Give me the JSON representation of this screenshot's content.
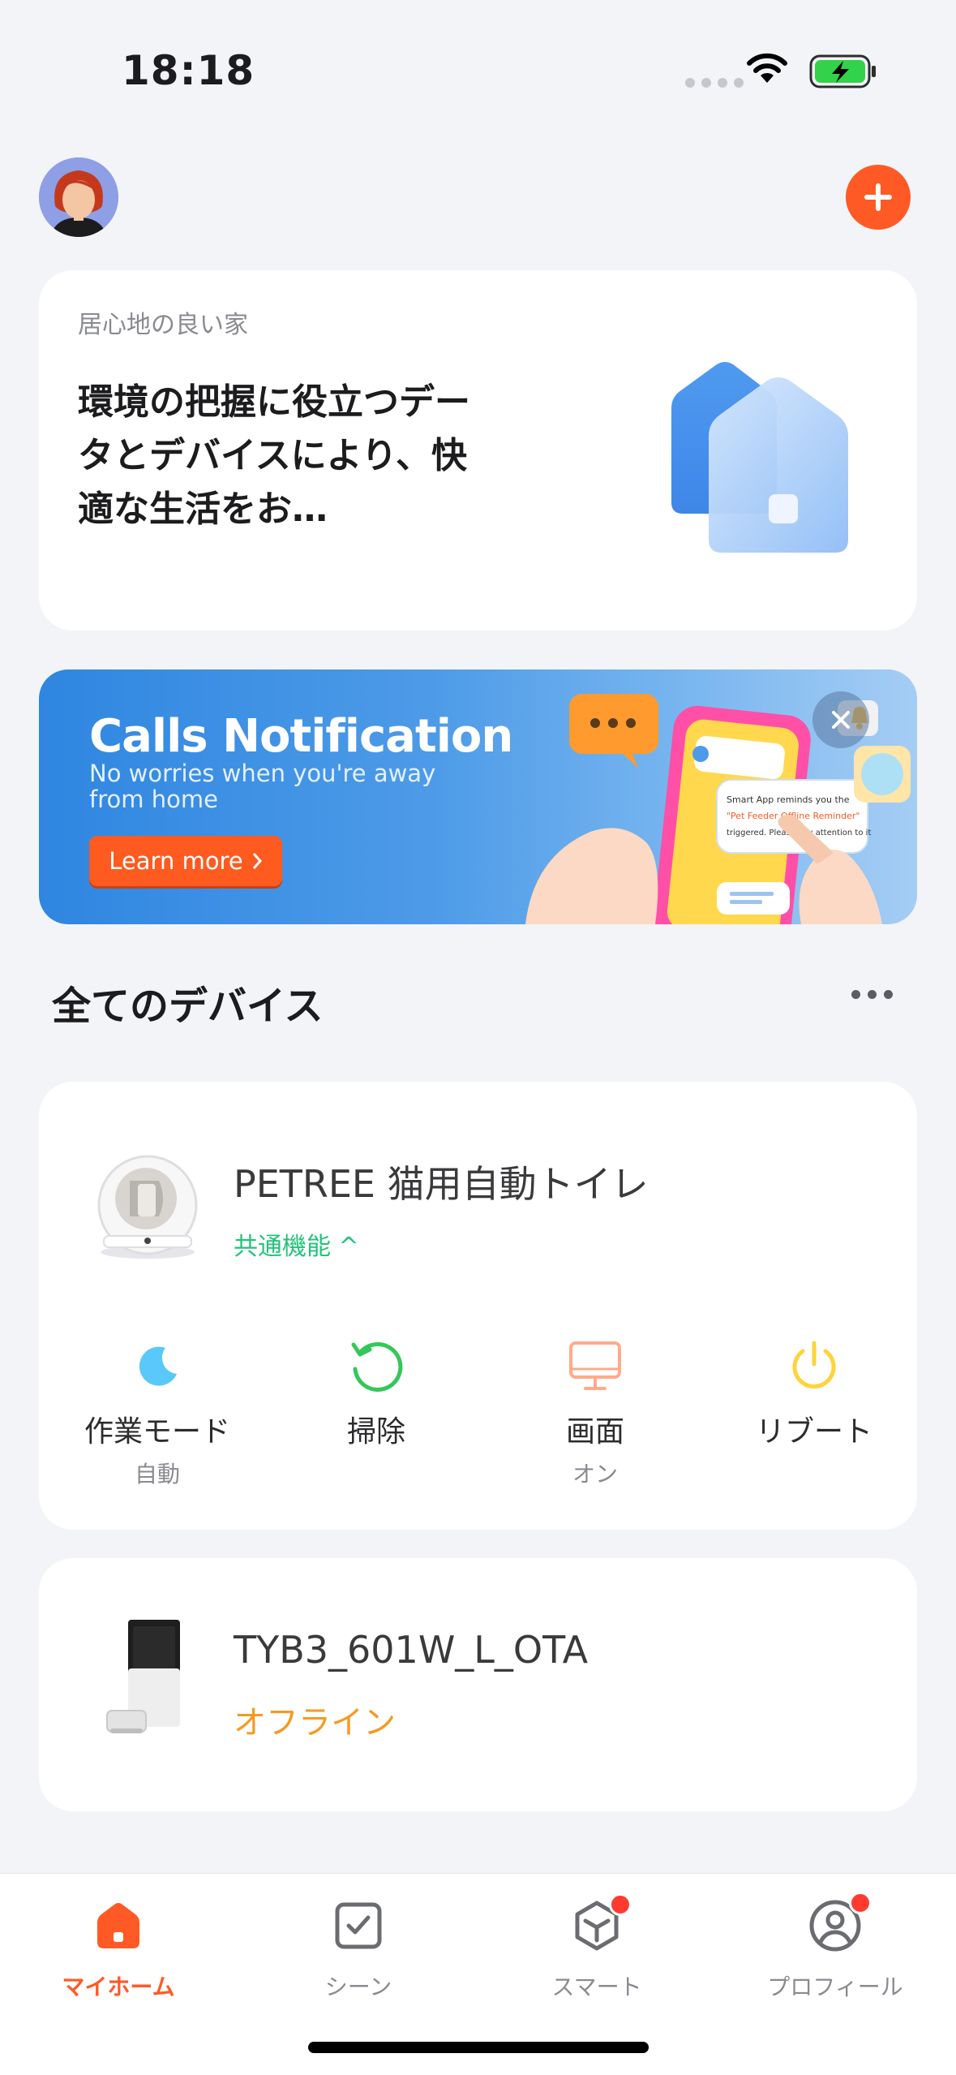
{
  "status_bar": {
    "time": "18:18"
  },
  "home_card": {
    "home_name": "居心地の良い家",
    "description": "環境の把握に役立つデータとデバイスにより、快適な生活をお…"
  },
  "banner": {
    "title": "Calls Notification",
    "subtitle": "No worries when you're away from home",
    "button_label": "Learn more",
    "phone_text_line1": "Smart App reminds you the",
    "phone_text_highlight": "\"Pet Feeder Offline Reminder\"",
    "phone_text_line3": "triggered. Please pay attention to it"
  },
  "devices_section": {
    "title": "全てのデバイス"
  },
  "devices": [
    {
      "name": "PETREE 猫用自動トイレ",
      "status": "共通機能 ^",
      "quick_actions": [
        {
          "label": "作業モード",
          "sub": "自動",
          "icon": "moon-icon",
          "color": "#5ac8fa"
        },
        {
          "label": "掃除",
          "sub": "",
          "icon": "refresh-icon",
          "color": "#34c759"
        },
        {
          "label": "画面",
          "sub": "オン",
          "icon": "monitor-icon",
          "color": "#ffab8a"
        },
        {
          "label": "リブート",
          "sub": "",
          "icon": "power-icon",
          "color": "#ffd43b"
        }
      ]
    },
    {
      "name": "TYB3_601W_L_OTA",
      "status": "オフライン"
    }
  ],
  "tab_bar": {
    "tabs": [
      {
        "label": "マイホーム",
        "icon": "home-icon",
        "active": true
      },
      {
        "label": "シーン",
        "icon": "checkbox-icon",
        "active": false
      },
      {
        "label": "スマート",
        "icon": "cube-icon",
        "active": false,
        "badge": true
      },
      {
        "label": "プロフィール",
        "icon": "profile-icon",
        "active": false,
        "badge": true
      }
    ]
  },
  "colors": {
    "accent": "#ff5a26",
    "online_green": "#22c37a",
    "offline_orange": "#f59a23"
  }
}
